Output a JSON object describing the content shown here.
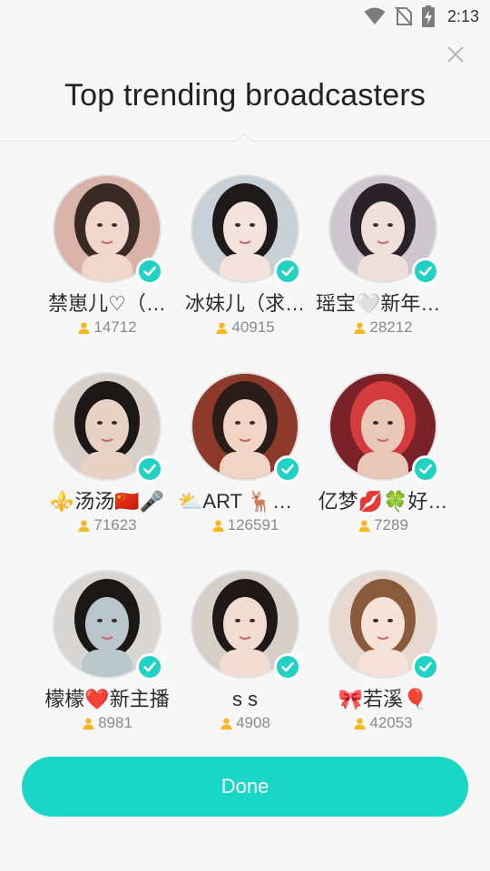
{
  "status_bar": {
    "time": "2:13",
    "icons": [
      "wifi-icon",
      "no-sim-icon",
      "battery-charging-icon"
    ]
  },
  "title": "Top trending broadcasters",
  "broadcasters": [
    {
      "name": "禁崽儿♡（…",
      "followers": "14712",
      "verified": true,
      "palette": [
        "#d9b3a8",
        "#3a2a26",
        "#f1d6cc"
      ]
    },
    {
      "name": "冰妹儿（求…",
      "followers": "40915",
      "verified": true,
      "palette": [
        "#c7d0d6",
        "#1e1a1a",
        "#f4e3dc"
      ]
    },
    {
      "name": "瑶宝🤍新年好…",
      "followers": "28212",
      "verified": true,
      "palette": [
        "#cfc7cf",
        "#2a2226",
        "#efe0dc"
      ]
    },
    {
      "name": "⚜️汤汤🇨🇳🎤",
      "followers": "71623",
      "verified": true,
      "palette": [
        "#d8cfc8",
        "#1d1818",
        "#e8d2c4"
      ]
    },
    {
      "name": "⛅ART 🦌鹿…",
      "followers": "126591",
      "verified": true,
      "palette": [
        "#8e3a2a",
        "#2a1c18",
        "#f0d4c6"
      ]
    },
    {
      "name": "亿梦💋🍀好…",
      "followers": "7289",
      "verified": true,
      "palette": [
        "#7a2228",
        "#d33b3e",
        "#e9c8b8"
      ]
    },
    {
      "name": "檬檬❤️新主播",
      "followers": "8981",
      "verified": true,
      "palette": [
        "#d8d6d2",
        "#1a1716",
        "#b9c6cc"
      ]
    },
    {
      "name": "s s",
      "followers": "4908",
      "verified": true,
      "palette": [
        "#d6cfc8",
        "#1e1818",
        "#f1dcd2"
      ]
    },
    {
      "name": "🎀若溪🎈",
      "followers": "42053",
      "verified": true,
      "palette": [
        "#e6d8cf",
        "#8a5a3c",
        "#f6e2d8"
      ]
    }
  ],
  "done_label": "Done",
  "colors": {
    "accent": "#19d6c6",
    "follower_icon": "#f5b81f"
  }
}
